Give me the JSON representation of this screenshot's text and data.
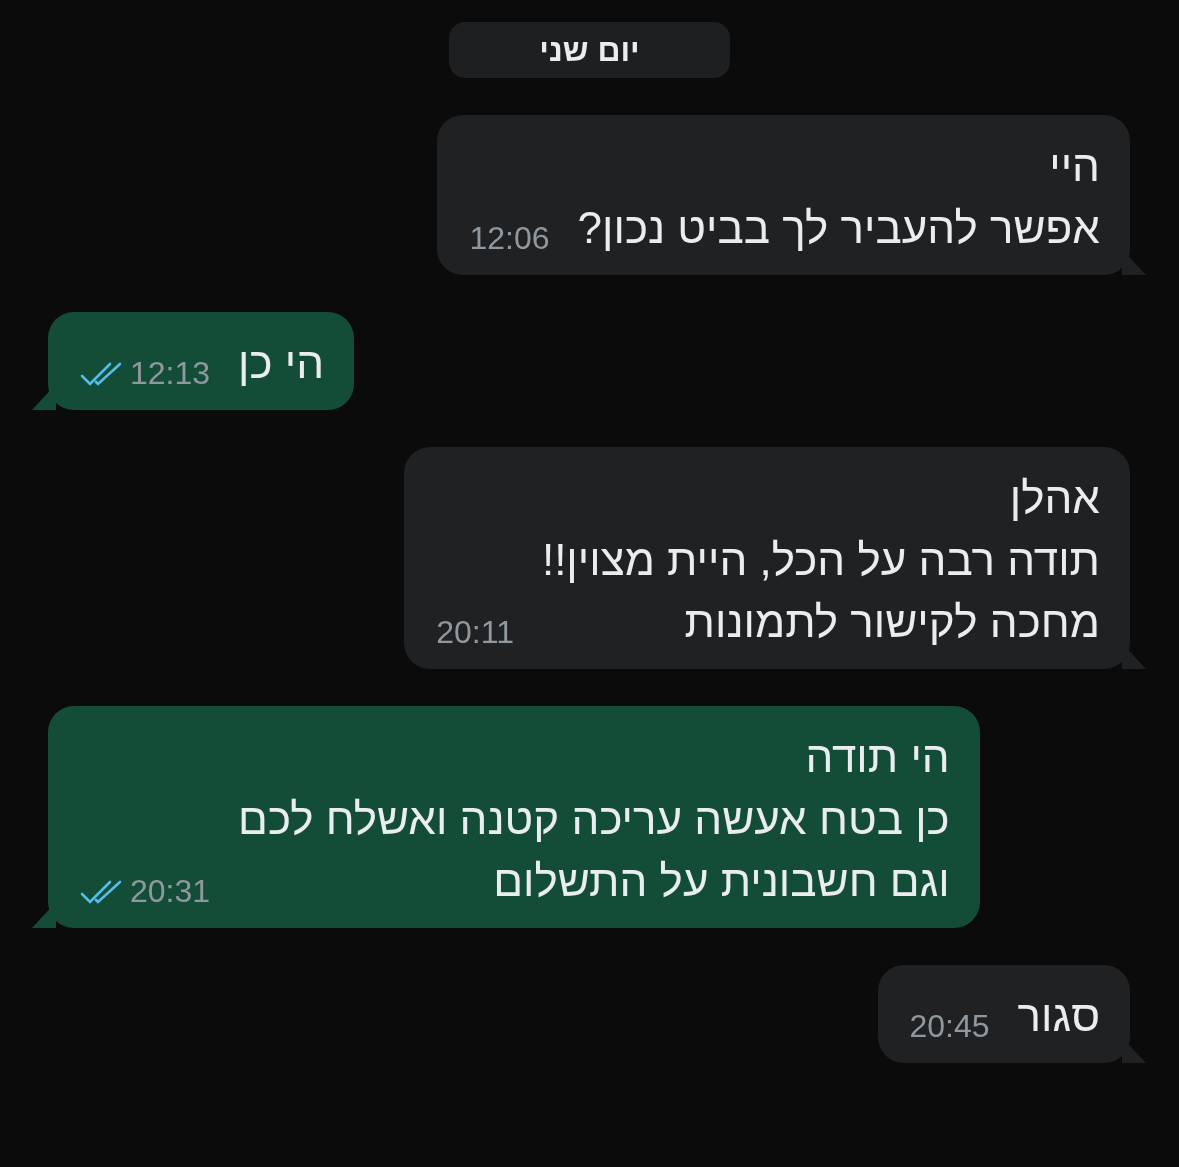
{
  "date_chip": "יום שני",
  "messages": [
    {
      "kind": "incoming",
      "text": "היי\nאפשר להעביר לך בביט נכון?",
      "time": "12:06"
    },
    {
      "kind": "outgoing",
      "text": "הי כן",
      "time": "12:13",
      "read": true
    },
    {
      "kind": "incoming",
      "text": "אהלן\nתודה רבה על הכל, היית מצוין!!\nמחכה לקישור לתמונות",
      "time": "20:11"
    },
    {
      "kind": "outgoing",
      "text": "הי תודה\nכן בטח אעשה עריכה קטנה ואשלח לכם\nוגם חשבונית על התשלום",
      "time": "20:31",
      "read": true
    },
    {
      "kind": "incoming",
      "text": "סגור",
      "time": "20:45"
    }
  ]
}
